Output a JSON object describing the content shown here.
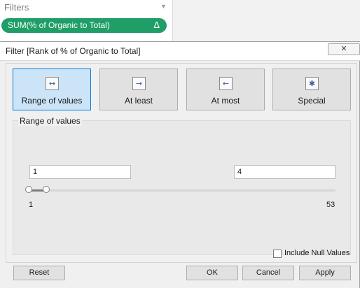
{
  "filters_shelf": {
    "title": "Filters",
    "menu_arrow": "▼",
    "pill_label": "SUM(% of Organic to Total)",
    "pill_delta": "Δ",
    "pill_color": "#1f9e68"
  },
  "dialog": {
    "title": "Filter [Rank of % of Organic to Total]",
    "close_glyph": "✕",
    "modes": [
      {
        "label": "Range of values",
        "icon": "range-icon",
        "glyph": "↔",
        "active": true
      },
      {
        "label": "At least",
        "icon": "at-least-icon",
        "glyph": "→",
        "active": false
      },
      {
        "label": "At most",
        "icon": "at-most-icon",
        "glyph": "←",
        "active": false
      },
      {
        "label": "Special",
        "icon": "special-icon",
        "glyph": "✱",
        "active": false
      }
    ],
    "range": {
      "caption": "Range of values",
      "min_input": "1",
      "max_input": "4",
      "axis_min": 1,
      "axis_max": 53,
      "axis_min_label": "1",
      "axis_max_label": "53",
      "selected_min": 1,
      "selected_max": 4
    },
    "include_null": {
      "label": "Include Null Values",
      "checked": false
    },
    "buttons": {
      "reset": "Reset",
      "ok": "OK",
      "cancel": "Cancel",
      "apply": "Apply"
    },
    "accent_color": "#0078d7"
  }
}
